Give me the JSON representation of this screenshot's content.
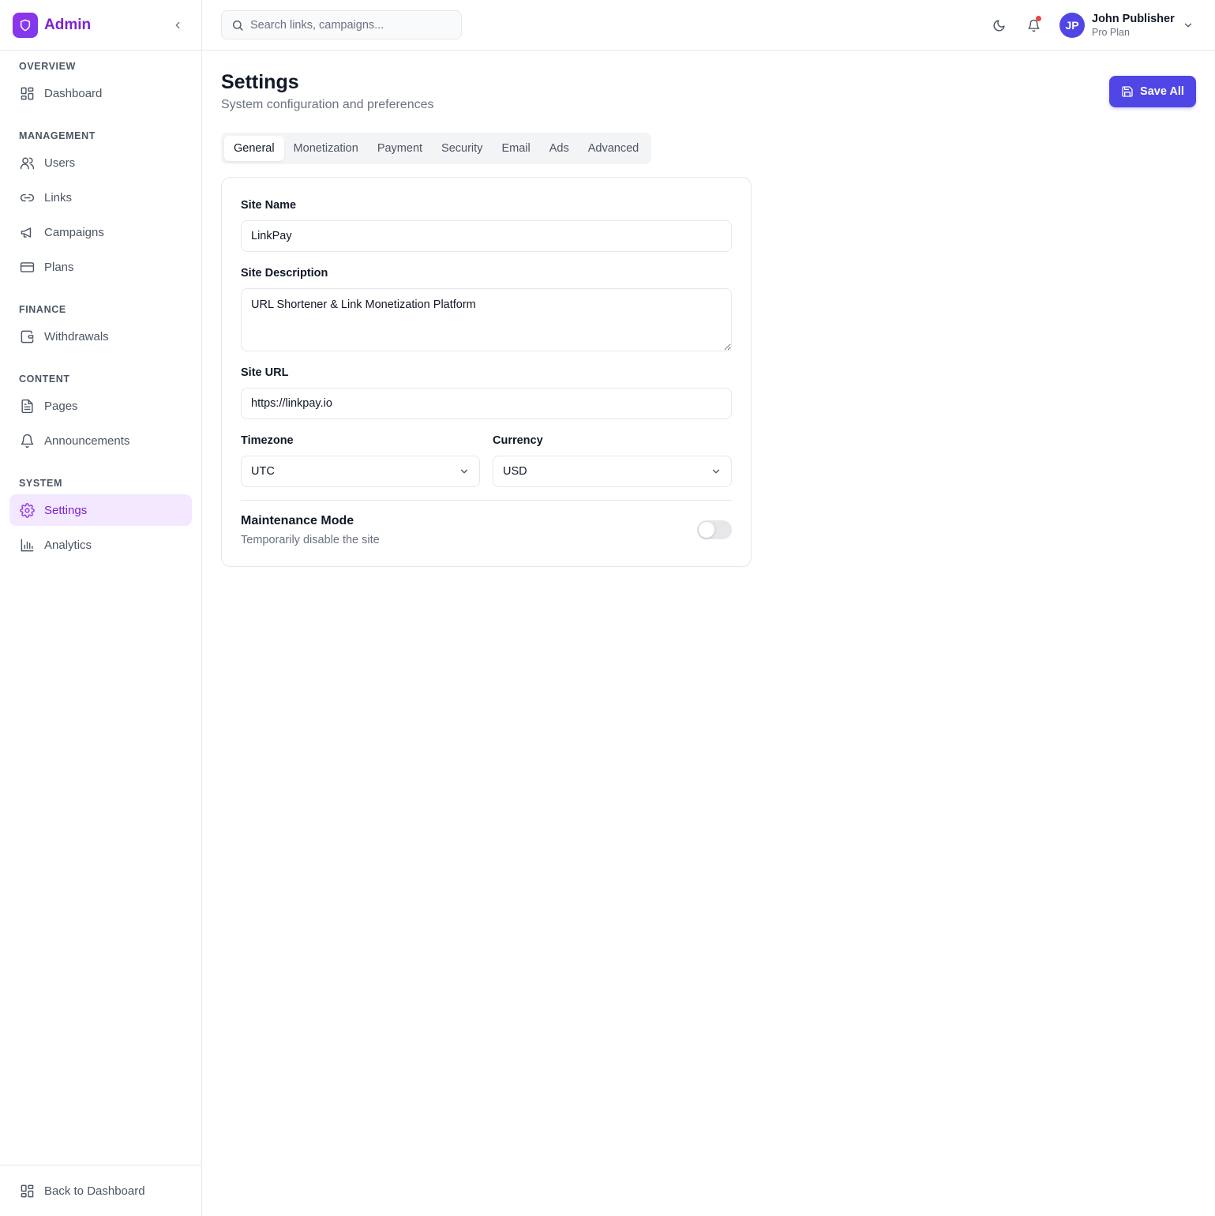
{
  "brand": {
    "name": "Admin",
    "logo_icon": "shield-icon",
    "accent": "#7e22ce"
  },
  "sidebar": {
    "sections": [
      {
        "heading": "OVERVIEW",
        "items": [
          {
            "label": "Dashboard",
            "icon": "dashboard-icon"
          }
        ]
      },
      {
        "heading": "MANAGEMENT",
        "items": [
          {
            "label": "Users",
            "icon": "users-icon"
          },
          {
            "label": "Links",
            "icon": "link-icon"
          },
          {
            "label": "Campaigns",
            "icon": "megaphone-icon"
          },
          {
            "label": "Plans",
            "icon": "credit-card-icon"
          }
        ]
      },
      {
        "heading": "FINANCE",
        "items": [
          {
            "label": "Withdrawals",
            "icon": "wallet-icon"
          }
        ]
      },
      {
        "heading": "CONTENT",
        "items": [
          {
            "label": "Pages",
            "icon": "file-text-icon"
          },
          {
            "label": "Announcements",
            "icon": "bell-icon"
          }
        ]
      },
      {
        "heading": "SYSTEM",
        "items": [
          {
            "label": "Settings",
            "icon": "gear-icon",
            "active": true
          },
          {
            "label": "Analytics",
            "icon": "bar-chart-icon"
          }
        ]
      }
    ],
    "footer": {
      "label": "Back to Dashboard",
      "icon": "dashboard-icon"
    }
  },
  "topbar": {
    "search_placeholder": "Search links, campaigns...",
    "user": {
      "initials": "JP",
      "name": "John Publisher",
      "plan": "Pro Plan",
      "avatar_color": "#4f46e5"
    },
    "notification_dot_color": "#ef4444"
  },
  "page": {
    "title": "Settings",
    "subtitle": "System configuration and preferences",
    "save_label": "Save All",
    "tabs": [
      "General",
      "Monetization",
      "Payment",
      "Security",
      "Email",
      "Ads",
      "Advanced"
    ],
    "active_tab": "General"
  },
  "form": {
    "site_name": {
      "label": "Site Name",
      "value": "LinkPay"
    },
    "site_description": {
      "label": "Site Description",
      "value": "URL Shortener & Link Monetization Platform"
    },
    "site_url": {
      "label": "Site URL",
      "value": "https://linkpay.io"
    },
    "timezone": {
      "label": "Timezone",
      "value": "UTC"
    },
    "currency": {
      "label": "Currency",
      "value": "USD"
    },
    "maintenance": {
      "title": "Maintenance Mode",
      "description": "Temporarily disable the site",
      "enabled": false
    }
  }
}
